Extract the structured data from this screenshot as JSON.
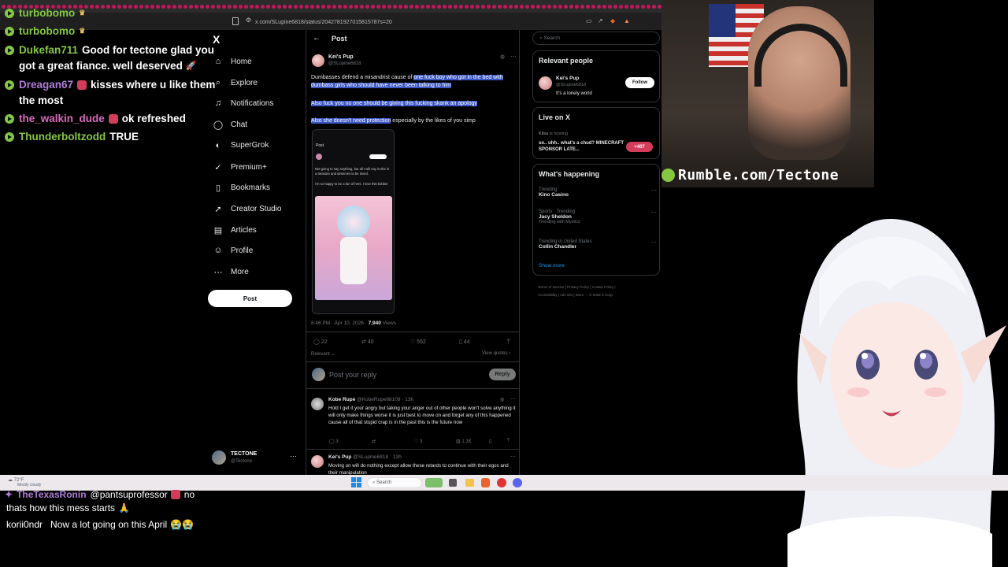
{
  "chat_top": [
    {
      "user": "turbobomo",
      "color": "#85c742",
      "message": ""
    },
    {
      "user": "turbobomo",
      "color": "#85c742",
      "message": ""
    },
    {
      "user": "Dukefan711",
      "color": "#85c742",
      "message": "Good for tectone glad you"
    },
    {
      "user": "",
      "color": "#ffffff",
      "message": "got a great fiance. well deserved"
    },
    {
      "user": "Dreagan67",
      "color": "#b07cd8",
      "message": "kisses where u like them"
    },
    {
      "user": "",
      "color": "#ffffff",
      "message": "the most"
    },
    {
      "user": "the_walkin_dude",
      "color": "#d86bbd",
      "message": "ok refreshed"
    },
    {
      "user": "Thunderboltzodd",
      "color": "#85c742",
      "message": "TRUE"
    }
  ],
  "chat_bottom": [
    {
      "user": "TheTexasRonin",
      "color": "#b07cd8",
      "message": "@pantsuprofessor"
    },
    {
      "user": "",
      "color": "#ffffff",
      "message": "no"
    },
    {
      "user": "",
      "color": "#ffffff",
      "message": "thats how this mess starts"
    },
    {
      "user": "korii0ndr",
      "color": "#ffffff",
      "message": "Now a lot going on this April"
    }
  ],
  "browser": {
    "url": "x.com/SLupine6818/status/2042781927015815787s=20"
  },
  "x_nav": {
    "logo": "X",
    "items": [
      {
        "label": "Home",
        "icon": "home-icon",
        "glyph": "⌂"
      },
      {
        "label": "Explore",
        "icon": "search-icon",
        "glyph": "⌕"
      },
      {
        "label": "Notifications",
        "icon": "bell-icon",
        "glyph": "♫"
      },
      {
        "label": "Chat",
        "icon": "chat-icon",
        "glyph": "◯"
      },
      {
        "label": "SuperGrok",
        "icon": "grok-icon",
        "glyph": "◐"
      },
      {
        "label": "Premium+",
        "icon": "premium-icon",
        "glyph": "✓"
      },
      {
        "label": "Bookmarks",
        "icon": "bookmark-icon",
        "glyph": "▯"
      },
      {
        "label": "Creator Studio",
        "icon": "rocket-icon",
        "glyph": "➚"
      },
      {
        "label": "Articles",
        "icon": "article-icon",
        "glyph": "▤"
      },
      {
        "label": "Profile",
        "icon": "profile-icon",
        "glyph": "☺"
      },
      {
        "label": "More",
        "icon": "more-icon",
        "glyph": "⋯"
      }
    ],
    "post_label": "Post",
    "account_name": "TECTONE",
    "account_handle": "@Tectone"
  },
  "post": {
    "header": "Post",
    "author": "Kei's Pup",
    "handle": "@SLupine6818",
    "line1_plain": "Dumbasses defend a misandrist cause of ",
    "line1_hl": "one fuck boy who got in the bed with dumbass girls who should have never been talking to him",
    "line2_hl": "Also fuck you no one should be giving this fucking skank an apology",
    "line3_hl": "Also she doesn't need protection",
    "line3_plain": " especially by the likes of you simp",
    "embed_title": "Post",
    "embed_text1": "Not going to say anything, but all I will say is she is a treasure and deserves to be loved.",
    "embed_text2": "I'm so happy to be a fan of hers. I love this bobber",
    "timestamp": "8:46 PM · Apr 10, 2026 ·",
    "views_count": "7,940",
    "views_label": "Views",
    "replies": "22",
    "reposts": "40",
    "likes": "552",
    "bookmarks": "44",
    "sort_label": "Relevant",
    "view_quotes": "View quotes",
    "reply_placeholder": "Post your reply",
    "reply_button": "Reply"
  },
  "replies": [
    {
      "author": "Kobe Rupe",
      "handle": "@KobeRupe68109 · 13h",
      "text": "Hold I get it your angry but taking your anger out of other people won't solve anything it will only make things worse it is just best to move on and forget any of this happened cause all of that stupid crap is in the past this is the future now",
      "replies": "3",
      "reposts": "",
      "likes": "3",
      "views": "1.1K"
    },
    {
      "author": "Kei's Pup",
      "handle": "@SLupine6818 · 13h",
      "text": "Moving on will do nothing except allow these retards to continue with their egos and their manipulation"
    }
  ],
  "right": {
    "search_placeholder": "Search",
    "relevant_title": "Relevant people",
    "person_name": "Kei's Pup",
    "person_handle": "@SLupine6818",
    "person_bio": "It's a lonely world",
    "follow_label": "Follow",
    "live_title": "Live on X",
    "live_host": "Kitsu",
    "live_host_suffix": "is hosting",
    "live_text": "so.. uhh.. what's a chud? MINECRAFT SPONSOR LATE...",
    "live_count": "+407",
    "happening_title": "What's happening",
    "trends": [
      {
        "context": "Trending",
        "name": "Kino Casino",
        "extra": ""
      },
      {
        "context": "Sports · Trending",
        "name": "Jacy Sheldon",
        "extra": "Trending with Mystics"
      },
      {
        "context": "Trending in United States",
        "name": "Collin Chandler",
        "extra": ""
      }
    ],
    "show_more": "Show more",
    "footer1": "Terms of Service  |  Privacy Policy  |  Cookie Policy  |",
    "footer2": "Accessibility  |  Ads info  |  More ···  © 2026 X Corp."
  },
  "overlay": {
    "rumble_text": "Rumble.com/Tectone"
  },
  "taskbar": {
    "weather_temp": "72°F",
    "weather_desc": "Mostly cloudy",
    "search_label": "Search"
  },
  "colors": {
    "accent": "#1d9bf0",
    "highlight": "#3b57c4",
    "rumble_green": "#85c742",
    "live_pink": "#d33d5b"
  }
}
